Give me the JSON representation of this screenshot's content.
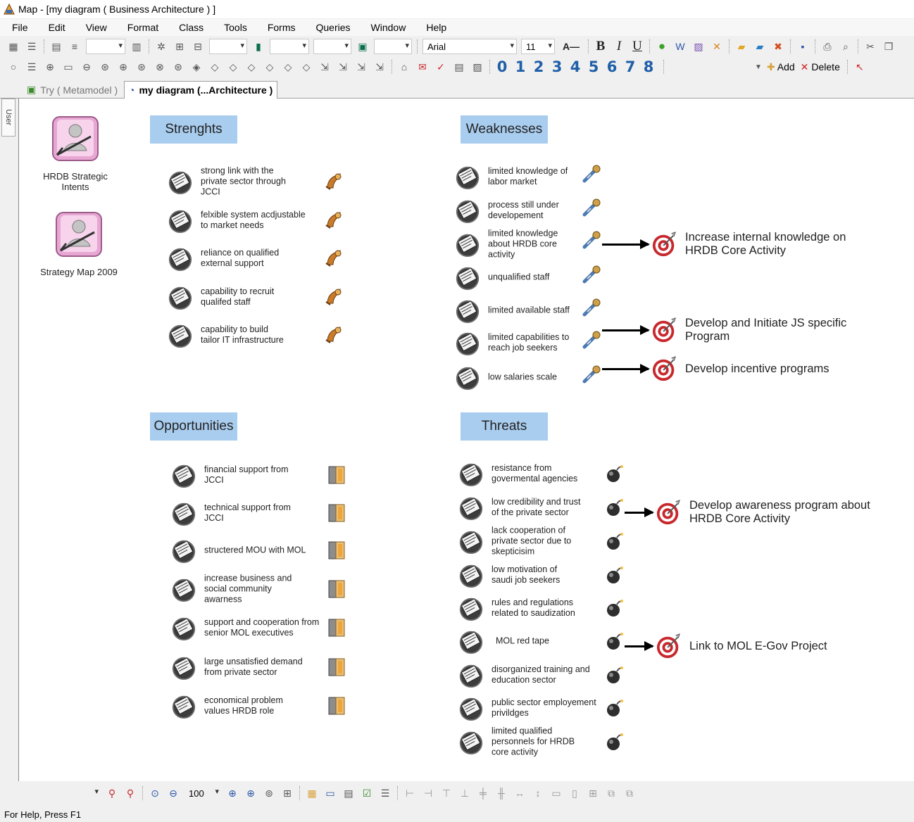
{
  "window": {
    "title": "Map - [my diagram ( Business Architecture ) ]"
  },
  "menu": [
    "File",
    "Edit",
    "View",
    "Format",
    "Class",
    "Tools",
    "Forms",
    "Queries",
    "Window",
    "Help"
  ],
  "toolbar": {
    "font_name": "Arial",
    "font_size": "11",
    "levels": [
      "0",
      "1",
      "2",
      "3",
      "4",
      "5",
      "6",
      "7",
      "8"
    ],
    "add_label": "Add",
    "delete_label": "Delete"
  },
  "tabs": {
    "inactive": "Try ( Metamodel )",
    "active": "my diagram (...Architecture )"
  },
  "sidebar": {
    "user_tab": "User"
  },
  "left_icons": [
    {
      "label": "HRDB Strategic\nIntents"
    },
    {
      "label": "Strategy Map 2009"
    }
  ],
  "sections": {
    "strengths": {
      "title": "Strenghts",
      "items": [
        "strong link with the\nprivate sector through\nJCCI",
        "felxible system acdjustable\nto market needs",
        "reliance on qualified\nexternal support",
        "capability to recruit\nqualifed staff",
        "capability to build\ntailor IT infrastructure"
      ]
    },
    "weaknesses": {
      "title": "Weaknesses",
      "items": [
        "limited knowledge of\nlabor market",
        "process still under\ndevelopement",
        "limited knowledge\nabout HRDB core\nactivity",
        "unqualified staff",
        "limited available staff",
        "limited capabilities to\nreach job seekers",
        "low salaries scale"
      ]
    },
    "opportunities": {
      "title": "Opportunities",
      "items": [
        "financial support from\nJCCI",
        "technical support from\nJCCI",
        "structered MOU with MOL",
        "increase business and\nsocial community\nawarness",
        "support and cooperation from\nsenior MOL executives",
        "large unsatisfied demand\nfrom private sector",
        "economical problem\nvalues HRDB role"
      ]
    },
    "threats": {
      "title": "Threats",
      "items": [
        "resistance from\ngovermental agencies",
        "low credibility and trust\nof the private sector",
        "lack cooperation of\nprivate sector due to\nskepticisim",
        "low motivation of\nsaudi job seekers",
        "rules and regulations\nrelated to saudization",
        "MOL red tape",
        "disorganized training and\neducation sector",
        "public sector employement\nprivildges",
        "limited qualified\npersonnels for HRDB\ncore activity"
      ]
    }
  },
  "goals": [
    "Increase internal knowledge on\nHRDB Core Activity",
    "Develop and Initiate JS specific\nProgram",
    "Develop incentive programs",
    "Develop awareness program about\nHRDB Core Activity",
    "Link to MOL E-Gov Project"
  ],
  "bottom_toolbar": {
    "zoom": "100"
  },
  "status": {
    "text": "For Help, Press F1"
  },
  "colors": {
    "header_bg": "#a9cdef",
    "target_red": "#c8282d",
    "level_blue": "#1f5fa8"
  }
}
